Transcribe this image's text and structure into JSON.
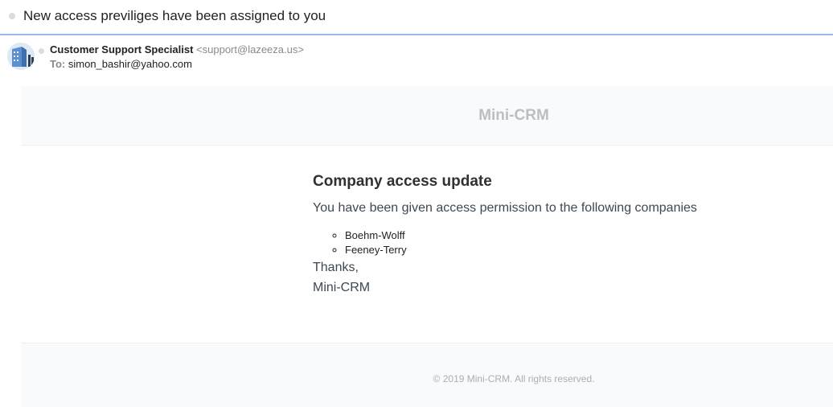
{
  "subject": "New access previliges have been assigned to you",
  "sender": {
    "name": "Customer Support Specialist",
    "email": "<support@lazeeza.us>"
  },
  "recipient": {
    "label": "To:",
    "email": "simon_bashir@yahoo.com"
  },
  "email": {
    "brand": "Mini-CRM",
    "heading": "Company access update",
    "intro": "You have been given access permission to the following companies",
    "companies": [
      "Boehm-Wolff",
      "Feeney-Terry"
    ],
    "thanks": "Thanks,",
    "signature": "Mini-CRM",
    "footer": "© 2019 Mini-CRM. All rights reserved."
  },
  "colors": {
    "accent_line": "#9bb8e6",
    "panel_background": "#f8fafc",
    "brand_text": "#bbbfc3"
  }
}
